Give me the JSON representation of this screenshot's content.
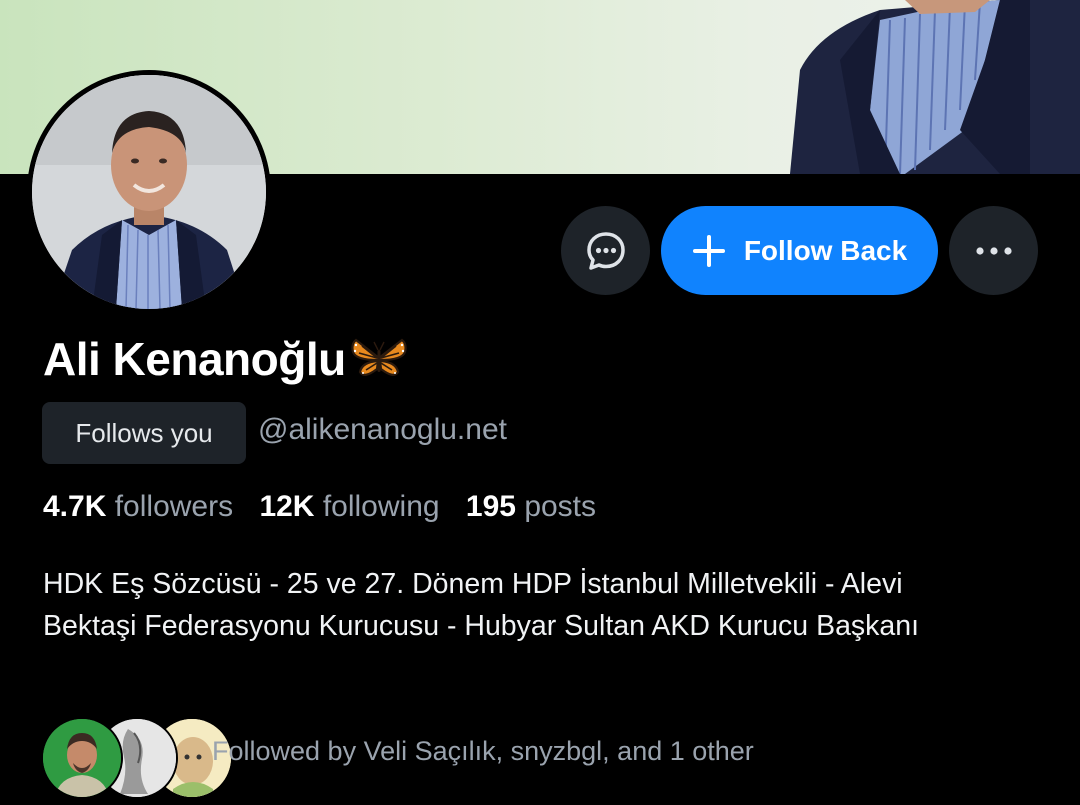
{
  "profile": {
    "display_name": "Ali Kenanoğlu",
    "name_emoji": "butterfly-emoji",
    "handle": "@alikenanoglu.net",
    "follows_you_label": "Follows you",
    "bio": "HDK Eş Sözcüsü - 25 ve 27. Dönem HDP İstanbul Milletvekili - Alevi Bektaşi Federasyonu Kurucusu - Hubyar Sultan AKD Kurucu Başkanı"
  },
  "stats": {
    "followers_count": "4.7K",
    "followers_label": "followers",
    "following_count": "12K",
    "following_label": "following",
    "posts_count": "195",
    "posts_label": "posts"
  },
  "actions": {
    "message_icon": "chat-bubble-icon",
    "follow_back_label": "Follow Back",
    "follow_icon": "plus-icon",
    "more_icon": "ellipsis-icon"
  },
  "followed_by": {
    "text": "Followed by Veli Saçılık, snyzbgl, and 1 other"
  },
  "colors": {
    "background": "#000000",
    "accent": "#1083fe",
    "button_dark": "#1e2329",
    "muted_text": "#9aa3ae"
  }
}
